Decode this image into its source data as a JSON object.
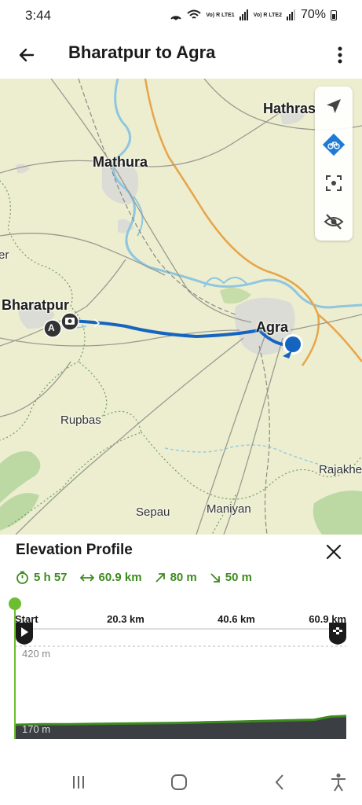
{
  "status_bar": {
    "time": "3:44",
    "lte1": "Vo) R LTE1",
    "lte2": "Vo) R LTE2",
    "battery": "70%"
  },
  "header": {
    "title": "Bharatpur to Agra"
  },
  "map": {
    "cities": {
      "hathras": "Hathras",
      "mathura": "Mathura",
      "bharatpur": "Bharatpur",
      "agra": "Agra"
    },
    "towns": {
      "rupbas": "Rupbas",
      "sepau": "Sepau",
      "maniyan": "Maniyan",
      "rajakhe": "Rajakhe",
      "er": "er"
    },
    "start_marker": "A",
    "route_color": "#1565c0"
  },
  "elevation": {
    "title": "Elevation Profile",
    "stats": {
      "duration": "5 h 57",
      "distance": "60.9 km",
      "ascent": "80 m",
      "descent": "50 m"
    },
    "axis": {
      "start": "Start",
      "tick1": "20.3 km",
      "tick2": "40.6 km",
      "tick3": "60.9 km"
    },
    "y_max_label": "420 m",
    "y_min_label": "170 m",
    "accent_color": "#3d8b1e"
  },
  "chart_data": {
    "type": "area",
    "x": [
      0,
      5,
      10,
      15,
      20.3,
      25,
      30,
      35,
      40.6,
      45,
      50,
      55,
      58,
      60.9
    ],
    "values": [
      170,
      172,
      172,
      173,
      174,
      175,
      176,
      178,
      180,
      182,
      184,
      186,
      196,
      198
    ],
    "xlabel": "",
    "ylabel": "",
    "xlim": [
      0,
      60.9
    ],
    "ylim": [
      170,
      420
    ]
  }
}
